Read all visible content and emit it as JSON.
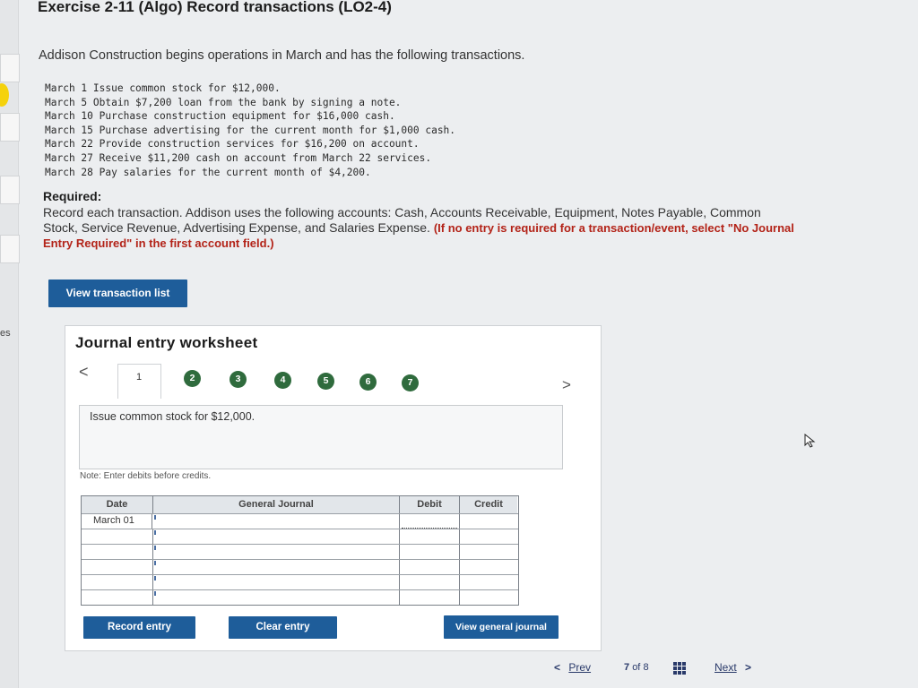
{
  "exercise": {
    "title": "Exercise 2-11 (Algo) Record transactions (LO2-4)",
    "intro": "Addison Construction begins operations in March and has the following transactions."
  },
  "transactions": [
    {
      "date": "March 1",
      "text": "Issue common stock for $12,000."
    },
    {
      "date": "March 5",
      "text": "Obtain $7,200 loan from the bank by signing a note."
    },
    {
      "date": "March 10",
      "text": "Purchase construction equipment for $16,000 cash."
    },
    {
      "date": "March 15",
      "text": "Purchase advertising for the current month for $1,000 cash."
    },
    {
      "date": "March 22",
      "text": "Provide construction services for $16,200 on account."
    },
    {
      "date": "March 27",
      "text": "Receive $11,200 cash on account from March 22 services."
    },
    {
      "date": "March 28",
      "text": "Pay salaries for the current month of $4,200."
    }
  ],
  "required": {
    "heading": "Required:",
    "body": "Record each transaction. Addison uses the following accounts: Cash, Accounts Receivable, Equipment, Notes Payable, Common Stock, Service Revenue, Advertising Expense, and Salaries Expense.",
    "note_red": "(If no entry is required for a transaction/event, select \"No Journal Entry Required\" in the first account field.)"
  },
  "buttons": {
    "view_transaction_list": "View transaction list",
    "record_entry": "Record entry",
    "clear_entry": "Clear entry",
    "view_general_journal": "View general journal"
  },
  "side_label": "es",
  "worksheet": {
    "title": "Journal entry worksheet",
    "prev_chevron": "<",
    "next_chevron": ">",
    "tabs": [
      "1",
      "2",
      "3",
      "4",
      "5",
      "6",
      "7"
    ],
    "active_tab": 1,
    "description": "Issue common stock for $12,000.",
    "note": "Note: Enter debits before credits.",
    "columns": {
      "date": "Date",
      "general_journal": "General Journal",
      "debit": "Debit",
      "credit": "Credit"
    },
    "first_date": "March 01"
  },
  "pagination": {
    "prev": "Prev",
    "current": "7",
    "of": "of",
    "total": "8",
    "next": "Next",
    "prev_chevron": "<",
    "next_chevron": ">"
  },
  "colors": {
    "button_blue": "#1e5d9a",
    "tab_green": "#2f6b3d",
    "required_red": "#b32318"
  }
}
